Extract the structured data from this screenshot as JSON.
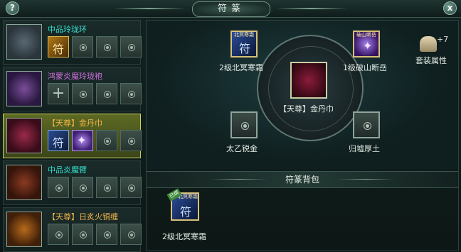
{
  "window": {
    "title": "符篆",
    "help_label": "?",
    "close_label": "x"
  },
  "equipment": [
    {
      "name": "中品玲珑环",
      "name_color": "#36e0cf",
      "selected": false,
      "slots": [
        {
          "type": "rune-y",
          "glyph": "符"
        },
        {
          "type": "empty"
        },
        {
          "type": "empty"
        },
        {
          "type": "empty"
        }
      ]
    },
    {
      "name": "鸿蒙炎魔玲珑袍",
      "name_color": "#d26fe0",
      "selected": false,
      "slots": [
        {
          "type": "plus",
          "glyph": "+"
        },
        {
          "type": "empty"
        },
        {
          "type": "empty"
        },
        {
          "type": "empty"
        }
      ]
    },
    {
      "name": "【天尊】金丹巾",
      "name_color": "#f0b44a",
      "selected": true,
      "slots": [
        {
          "type": "rune-b",
          "glyph": "符"
        },
        {
          "type": "rune-p",
          "glyph": "✦"
        },
        {
          "type": "empty"
        },
        {
          "type": "empty"
        }
      ]
    },
    {
      "name": "中品炎魔臂",
      "name_color": "#36e0cf",
      "selected": false,
      "slots": [
        {
          "type": "empty"
        },
        {
          "type": "empty"
        },
        {
          "type": "empty"
        },
        {
          "type": "empty"
        }
      ]
    },
    {
      "name": "【天尊】日炙火铜缠",
      "name_color": "#f0b44a",
      "selected": false,
      "slots": [
        {
          "type": "empty"
        },
        {
          "type": "empty"
        },
        {
          "type": "empty"
        },
        {
          "type": "empty"
        }
      ]
    }
  ],
  "detail": {
    "center_item_name": "【天尊】金丹巾",
    "slot_top_left": {
      "label": "2级北冥寒霜",
      "tag": "北冥寒霜"
    },
    "slot_top_right": {
      "label": "1级破山断岳",
      "tag": "破山断岳"
    },
    "slot_bottom_left": {
      "label": "太乙锐金"
    },
    "slot_bottom_right": {
      "label": "归墟厚土"
    },
    "set_attr": {
      "label": "套装属性",
      "count": "+7"
    }
  },
  "bag": {
    "title": "符篆背包",
    "items": [
      {
        "label": "2级北冥寒霜",
        "tag": "北冥寒霜",
        "badge": "已绑"
      }
    ]
  },
  "colors": {
    "accent_teal": "#36e0cf",
    "accent_purple": "#d26fe0",
    "accent_gold": "#f0b44a",
    "selected_row": "#5d6a23"
  }
}
